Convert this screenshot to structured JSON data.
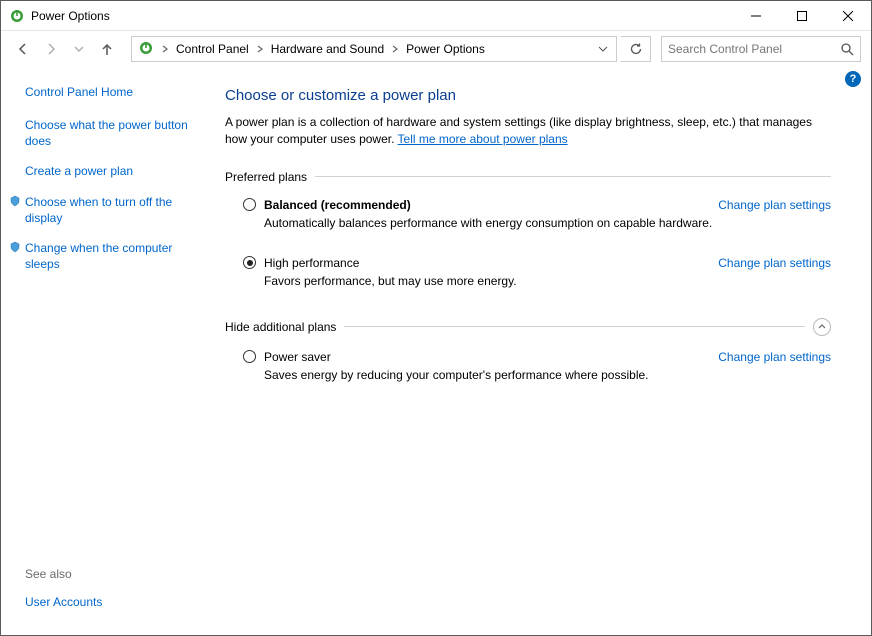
{
  "title": "Power Options",
  "breadcrumb": {
    "items": [
      "Control Panel",
      "Hardware and Sound",
      "Power Options"
    ]
  },
  "search": {
    "placeholder": "Search Control Panel"
  },
  "sidebar": {
    "home": "Control Panel Home",
    "tasks": [
      "Choose what the power button does",
      "Create a power plan",
      "Choose when to turn off the display",
      "Change when the computer sleeps"
    ],
    "see_also_label": "See also",
    "see_also_links": [
      "User Accounts"
    ]
  },
  "content": {
    "heading": "Choose or customize a power plan",
    "description_prefix": "A power plan is a collection of hardware and system settings (like display brightness, sleep, etc.) that manages how your computer uses power. ",
    "description_link": "Tell me more about power plans",
    "group_preferred_label": "Preferred plans",
    "group_additional_label": "Hide additional plans",
    "change_link_label": "Change plan settings",
    "plans_preferred": [
      {
        "name": "Balanced (recommended)",
        "desc": "Automatically balances performance with energy consumption on capable hardware.",
        "selected": false,
        "bold": true
      },
      {
        "name": "High performance",
        "desc": "Favors performance, but may use more energy.",
        "selected": true,
        "bold": false
      }
    ],
    "plans_additional": [
      {
        "name": "Power saver",
        "desc": "Saves energy by reducing your computer's performance where possible.",
        "selected": false,
        "bold": false
      }
    ]
  }
}
